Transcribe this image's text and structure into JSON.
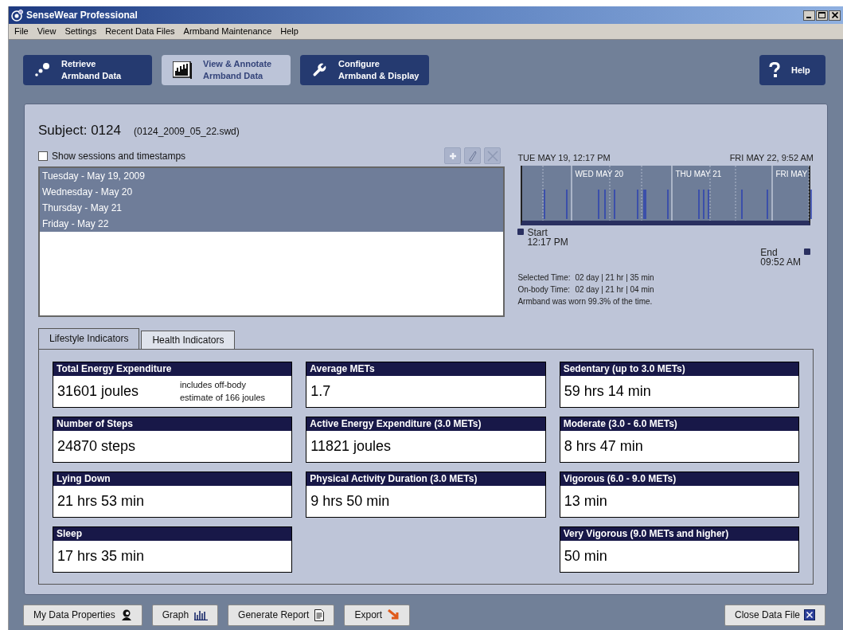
{
  "window": {
    "title": "SenseWear Professional"
  },
  "menu": [
    {
      "label": "File"
    },
    {
      "label": "View"
    },
    {
      "label": "Settings"
    },
    {
      "label": "Recent Data Files"
    },
    {
      "label": "Armband Maintenance"
    },
    {
      "label": "Help"
    }
  ],
  "nav_buttons": [
    {
      "kind": "retrieve",
      "lines": [
        "Retrieve",
        "Armband Data"
      ],
      "selected": false
    },
    {
      "kind": "view",
      "lines": [
        "View & Annotate",
        "Armband Data"
      ],
      "selected": true
    },
    {
      "kind": "configure",
      "lines": [
        "Configure",
        "Armband & Display"
      ],
      "selected": false
    }
  ],
  "help_button": {
    "label": "Help"
  },
  "subject": {
    "title": "Subject: 0124",
    "file": "(0124_2009_05_22.swd)"
  },
  "show_sessions": {
    "label": "Show sessions and timestamps",
    "checked": false
  },
  "session_tools": [
    {
      "kind": "add",
      "disabled": true
    },
    {
      "kind": "edit",
      "disabled": true
    },
    {
      "kind": "delete",
      "disabled": true
    }
  ],
  "days": [
    {
      "label": "Tuesday - May 19, 2009",
      "selected": true
    },
    {
      "label": "Wednesday - May 20",
      "selected": true
    },
    {
      "label": "Thursday - May 21",
      "selected": true
    },
    {
      "label": "Friday - May 22",
      "selected": true
    }
  ],
  "timeline": {
    "start_date": "TUE MAY 19, 12:17 PM",
    "end_date": "FRI MAY 22, 9:52 AM",
    "day_labels": [
      "WED MAY 20",
      "THU MAY 21",
      "FRI MAY"
    ],
    "start": {
      "label": "Start",
      "time": "12:17 PM"
    },
    "end": {
      "label": "End",
      "time": "09:52 AM"
    },
    "stats": [
      {
        "label": "Selected Time:",
        "value": "02 day | 21 hr | 35 min"
      },
      {
        "label": "On-body Time:",
        "value": "02 day | 21 hr | 04 min"
      }
    ],
    "summary": "Armband was worn 99.3% of the time."
  },
  "tabs": [
    {
      "label": "Lifestyle Indicators",
      "selected": true
    },
    {
      "label": "Health Indicators",
      "selected": false
    }
  ],
  "columns": [
    [
      {
        "title": "Total Energy Expenditure",
        "value": "31601 joules",
        "note": "includes off-body estimate of 166 joules"
      },
      {
        "title": "Number of Steps",
        "value": "24870 steps"
      },
      {
        "title": "Lying Down",
        "value": "21 hrs 53 min"
      },
      {
        "title": "Sleep",
        "value": "17 hrs 35 min"
      }
    ],
    [
      {
        "title": "Average METs",
        "value": "1.7"
      },
      {
        "title": "Active Energy Expenditure (3.0 METs)",
        "value": "11821 joules"
      },
      {
        "title": "Physical Activity Duration (3.0 METs)",
        "value": "9 hrs 50 min"
      }
    ],
    [
      {
        "title": "Sedentary  (up to 3.0 METs)",
        "value": "59 hrs 14 min"
      },
      {
        "title": "Moderate  (3.0 - 6.0 METs)",
        "value": "8 hrs 47 min"
      },
      {
        "title": "Vigorous  (6.0 - 9.0 METs)",
        "value": "13 min"
      },
      {
        "title": "Very Vigorous  (9.0 METs and higher)",
        "value": "50 min"
      }
    ]
  ],
  "bottom_buttons": [
    {
      "kind": "properties",
      "label": "My Data Properties"
    },
    {
      "kind": "graph",
      "label": "Graph"
    },
    {
      "kind": "report",
      "label": "Generate Report"
    },
    {
      "kind": "export",
      "label": "Export"
    }
  ],
  "close_button": {
    "kind": "close",
    "label": "Close Data File"
  }
}
